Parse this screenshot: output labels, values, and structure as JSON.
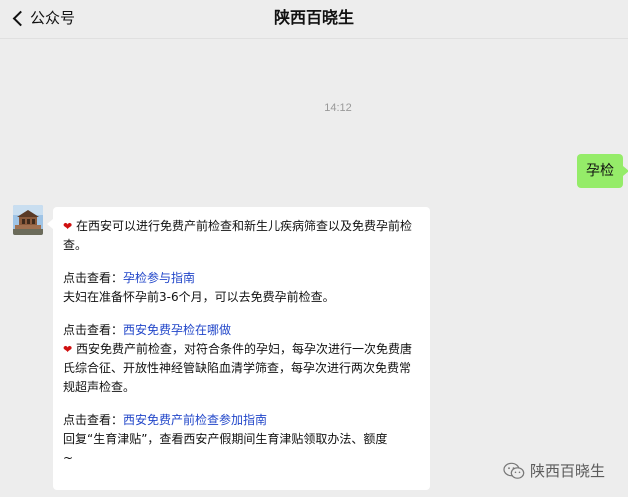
{
  "header": {
    "back_label": "公众号",
    "title": "陕西百晓生"
  },
  "chat": {
    "time": "14:12",
    "outgoing_message": "孕检",
    "reply": {
      "heart1": "❤",
      "intro": " 在西安可以进行免费产前检查和新生儿疾病筛查以及免费孕前检查。",
      "item1_prefix": "点击查看：",
      "item1_link": "孕检参与指南",
      "item1_desc": "夫妇在准备怀孕前3-6个月，可以去免费孕前检查。",
      "item2_prefix": "点击查看：",
      "item2_link": "西安免费孕检在哪做",
      "heart2": "❤",
      "item2_desc": " 西安免费产前检查，对符合条件的孕妇，每孕次进行一次免费唐氏综合征、开放性神经管缺陷血清学筛查，每孕次进行两次免费常规超声检查。",
      "item3_prefix": "点击查看：",
      "item3_link": "西安免费产前检查参加指南",
      "item3_desc": "回复“生育津贴”，查看西安产假期间生育津贴领取办法、额度",
      "tail": "~"
    }
  },
  "watermark": {
    "text": "陕西百晓生"
  },
  "colors": {
    "background": "#ededed",
    "outgoing_bubble": "#95ec69",
    "link": "#2146c9"
  }
}
